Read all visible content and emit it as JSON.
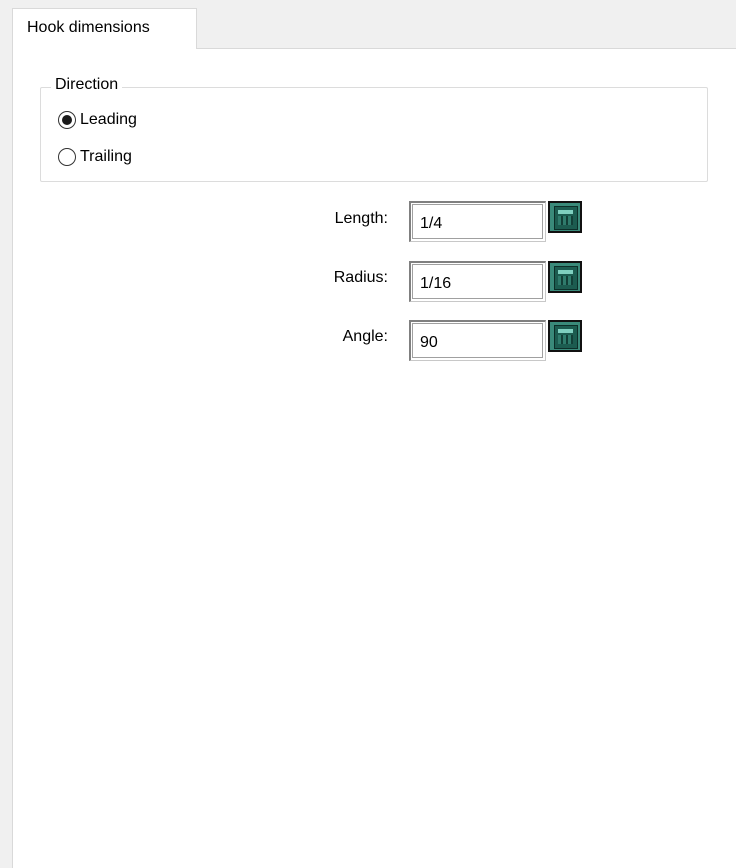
{
  "tabs": [
    {
      "label": "Hook dimensions",
      "selected": true
    }
  ],
  "direction": {
    "title": "Direction",
    "options": [
      {
        "label": "Leading",
        "checked": true
      },
      {
        "label": "Trailing",
        "checked": false
      }
    ]
  },
  "fields": {
    "length": {
      "label": "Length:",
      "value": "1/4"
    },
    "radius": {
      "label": "Radius:",
      "value": "1/16"
    },
    "angle": {
      "label": "Angle:",
      "value": "90"
    }
  },
  "icons": {
    "calculator": "calculator-icon"
  },
  "colors": {
    "calculator": "#3a8a7a",
    "panel": "#ffffff",
    "background": "#f0f0f0"
  }
}
